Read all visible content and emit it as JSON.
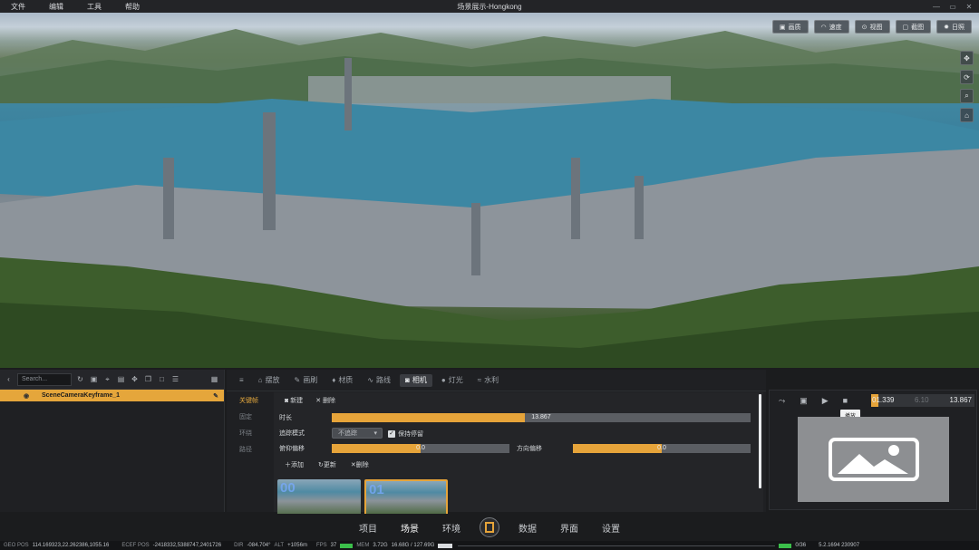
{
  "app": {
    "title": "场景展示-Hongkong",
    "menu": [
      "文件",
      "编辑",
      "工具",
      "帮助"
    ],
    "window_controls": [
      "—",
      "▭",
      "✕"
    ]
  },
  "viewport": {
    "buttons": [
      {
        "icon": "image-icon",
        "label": "画质"
      },
      {
        "icon": "speed-icon",
        "label": "速度"
      },
      {
        "icon": "view-icon",
        "label": "视图"
      },
      {
        "icon": "screenshot-icon",
        "label": "截图"
      },
      {
        "icon": "sun-icon",
        "label": "日照"
      }
    ],
    "side_tools": [
      "move-icon",
      "orbit-icon",
      "zoom-icon",
      "reset-icon"
    ]
  },
  "outliner": {
    "search_placeholder": "Search...",
    "items": [
      {
        "label": "SceneCameraKeyframe_1",
        "selected": true
      }
    ]
  },
  "tabs": [
    {
      "label": "摆放",
      "active": false
    },
    {
      "label": "画刷",
      "active": false
    },
    {
      "label": "材质",
      "active": false
    },
    {
      "label": "路线",
      "active": false
    },
    {
      "label": "相机",
      "active": true
    },
    {
      "label": "灯光",
      "active": false
    },
    {
      "label": "水利",
      "active": false
    }
  ],
  "camera_subnav": [
    {
      "label": "关键帧",
      "active": true
    },
    {
      "label": "固定",
      "active": false
    },
    {
      "label": "环绕",
      "active": false
    },
    {
      "label": "路径",
      "active": false
    }
  ],
  "keyframe_editor": {
    "new_label": "新建",
    "delete_label": "删除",
    "duration_label": "时长",
    "duration_value": "13.867",
    "duration_fill": 0.46,
    "tracking_label": "追踪模式",
    "tracking_value": "不追踪",
    "hold_label": "保持停留",
    "hold_checked": true,
    "pitch_label": "俯仰偏移",
    "pitch_value": "0.0",
    "pitch_fill": 0.5,
    "yaw_label": "方向偏移",
    "yaw_value": "0.0",
    "yaw_fill": 0.5,
    "add_label": "添加",
    "update_label": "更新",
    "remove_label": "删除",
    "thumbnails": [
      {
        "label": "00",
        "selected": false
      },
      {
        "label": "01",
        "selected": true
      }
    ]
  },
  "timeline": {
    "current": "01.339",
    "mid": "6.10",
    "end": "13.867",
    "tooltip": "播放"
  },
  "bottom_nav": [
    {
      "label": "项目",
      "active": false
    },
    {
      "label": "场景",
      "active": true
    },
    {
      "label": "环境",
      "active": false
    },
    {
      "label": "数据",
      "active": false
    },
    {
      "label": "界面",
      "active": false
    },
    {
      "label": "设置",
      "active": false
    }
  ],
  "status": {
    "geo_label": "GEO POS",
    "geo_value": "114.169323,22.262386,1055.16",
    "ecef_label": "ECEF POS",
    "ecef_value": "-2418332,5388747,2401726",
    "dir_label": "DIR",
    "dir_value": "-084.704°",
    "alt_label": "ALT",
    "alt_value": "+1056m",
    "fps_label": "FPS",
    "fps_value": "37",
    "mem_label": "MEM",
    "mem_value": "3.72G",
    "gpu_value": "16.68G / 127.69G",
    "count_value": "0/36",
    "version": "5.2.1694 230907"
  },
  "colors": {
    "accent": "#e6a43a",
    "panel": "#1f2023",
    "status_ok": "#3bbf4a"
  }
}
